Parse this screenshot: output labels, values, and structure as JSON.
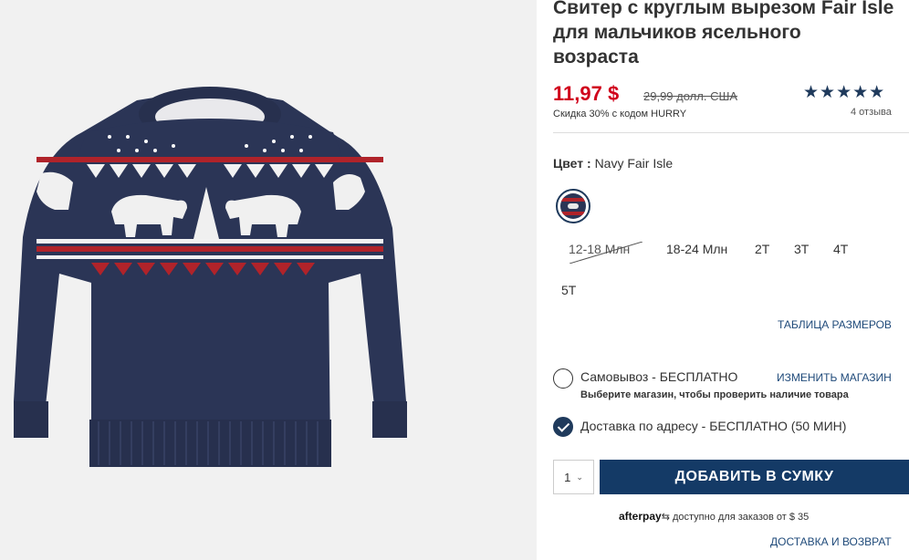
{
  "product": {
    "title_lines": [
      "Свитер с круглым вырезом Fair Isle",
      "для мальчиков ясельного",
      "возраста"
    ],
    "sale_price": "11,97 $",
    "original_price": "29,99 долл. США",
    "promo": "Скидка 30% с кодом HURRY",
    "rating_stars": "★★★★★",
    "rating_value": 5,
    "reviews": "4 отзыва"
  },
  "color": {
    "label": "Цвет :",
    "value": "Navy Fair Isle",
    "swatch_icon": "navy-fair-isle-swatch"
  },
  "sizes": [
    {
      "label": "12-18 Млн",
      "available": false
    },
    {
      "label": "18-24 Млн",
      "available": true
    },
    {
      "label": "2T",
      "available": true
    },
    {
      "label": "3T",
      "available": true
    },
    {
      "label": "4T",
      "available": true
    },
    {
      "label": "5T",
      "available": true
    }
  ],
  "size_chart": "ТАБЛИЦА РАЗМЕРОВ",
  "fulfillment": {
    "pickup_label": "Самовывоз - БЕСПЛАТНО",
    "change_store": "ИЗМЕНИТЬ МАГАЗИН",
    "pickup_note": "Выберите магазин, чтобы проверить наличие товара",
    "ship_label": "Доставка по адресу - БЕСПЛАТНО (50 МИН)",
    "selected": "ship"
  },
  "cart": {
    "quantity": "1",
    "add_label": "ДОБАВИТЬ В СУМКУ"
  },
  "afterpay": {
    "logo": "afterpay",
    "text": "доступно для заказов от $ 35"
  },
  "shipping_link": "ДОСТАВКА И ВОЗВРАТ",
  "colors": {
    "sale": "#d0011b",
    "navy": "#143a66",
    "link": "#1f4a7a",
    "sweater": "#2b3556",
    "red": "#b0232a"
  }
}
